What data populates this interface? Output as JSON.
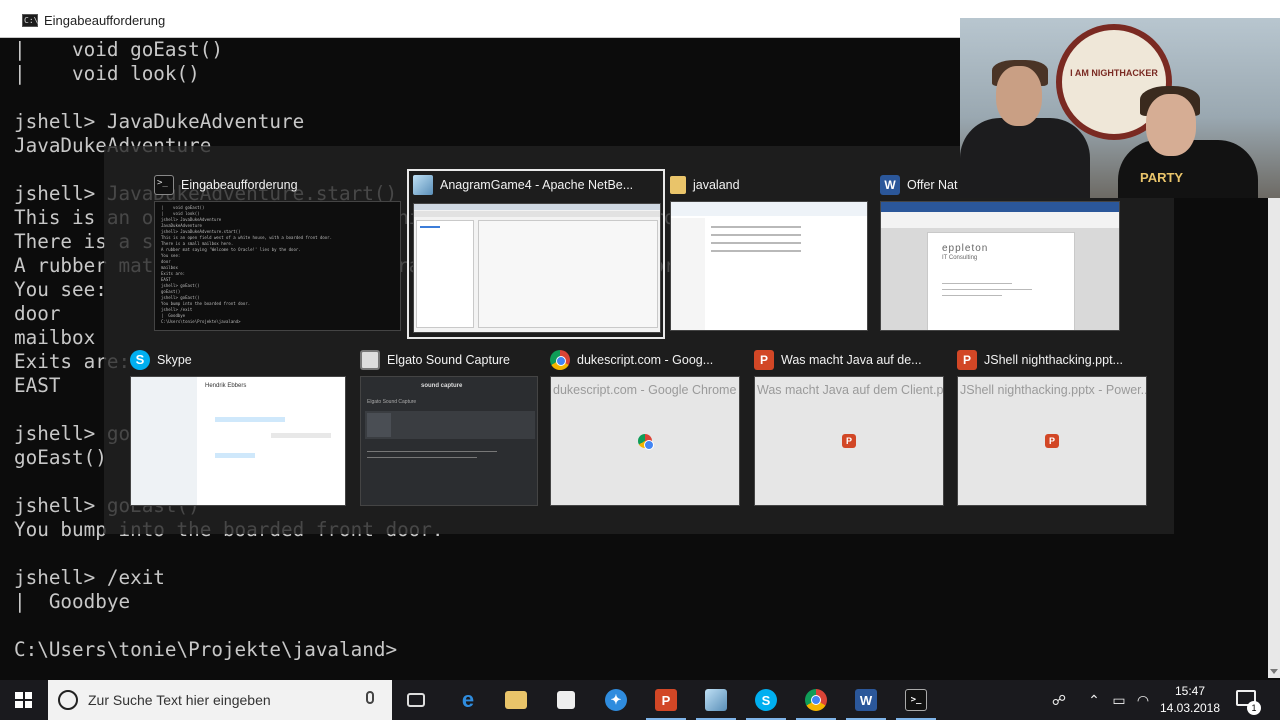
{
  "window": {
    "title": "Eingabeaufforderung",
    "icon": "cmd-icon"
  },
  "console": {
    "lines": [
      "|    void goEast()",
      "|    void look()",
      "",
      "jshell> JavaDukeAdventure",
      "JavaDukeAdventure",
      "",
      "jshell> JavaDukeAdventure.start()",
      "This is an open field west of a white house, with a boarded front door.",
      "There is a small mailbox here.",
      "A rubber mat saying 'Welcome to Oracle!' lies by the door.",
      "You see:",
      "door",
      "mailbox",
      "Exits are:",
      "EAST",
      "",
      "jshell> goEast()",
      "goEast()",
      "",
      "jshell> goEast()",
      "You bump into the boarded front door.",
      "",
      "jshell> /exit",
      "|  Goodbye",
      "",
      "C:\\Users\\tonie\\Projekte\\javaland>"
    ]
  },
  "task_switcher": {
    "row1": [
      {
        "label": "Eingabeaufforderung",
        "icon": "cmd-icon",
        "thumb": "console"
      },
      {
        "label": "AnagramGame4 - Apache NetBe...",
        "icon": "netbeans-icon",
        "thumb": "ide",
        "selected": true
      },
      {
        "label": "javaland",
        "icon": "folder-icon",
        "thumb": "explorer"
      },
      {
        "label": "Offer Nat",
        "icon": "word-icon",
        "thumb": "document",
        "doc_brand": "eppleton",
        "doc_sub": "IT Consulting"
      }
    ],
    "row2": [
      {
        "label": "Skype",
        "icon": "skype-icon",
        "thumb": "chat",
        "chat_name": "Hendrik Ebbers"
      },
      {
        "label": "Elgato Sound Capture",
        "icon": "elgato-icon",
        "thumb": "audio",
        "app_header": "sound capture",
        "app_title": "Elgato Sound Capture"
      },
      {
        "label": "dukescript.com - Goog...",
        "icon": "chrome-icon",
        "thumb": "blank",
        "ghost": "dukescript.com - Google Chrome"
      },
      {
        "label": "Was macht Java auf de...",
        "icon": "powerpoint-icon",
        "thumb": "blank",
        "ghost": "Was macht Java auf dem Client.p..."
      },
      {
        "label": "JShell nighthacking.ppt...",
        "icon": "powerpoint-icon",
        "thumb": "blank",
        "ghost": "JShell nighthacking.pptx - Power..."
      }
    ]
  },
  "webcam": {
    "logo_text": "I AM NIGHTHACKER",
    "shirt_text": "PARTY"
  },
  "taskbar": {
    "search_placeholder": "Zur Suche Text hier eingeben",
    "pinned": [
      {
        "name": "task-view-icon"
      },
      {
        "name": "edge-icon"
      },
      {
        "name": "file-explorer-icon"
      },
      {
        "name": "store-icon"
      },
      {
        "name": "safari-like-icon"
      },
      {
        "name": "powerpoint-icon"
      },
      {
        "name": "netbeans-icon"
      },
      {
        "name": "skype-icon"
      },
      {
        "name": "chrome-icon"
      },
      {
        "name": "word-icon"
      },
      {
        "name": "cmd-icon"
      }
    ],
    "time": "15:47",
    "date": "14.03.2018",
    "notification_count": "1"
  },
  "colors": {
    "console_bg": "#0c0c0c",
    "console_fg": "#c8c8c8",
    "taskbar_bg": "#1a1a1e",
    "accent": "#7fb4e8"
  }
}
